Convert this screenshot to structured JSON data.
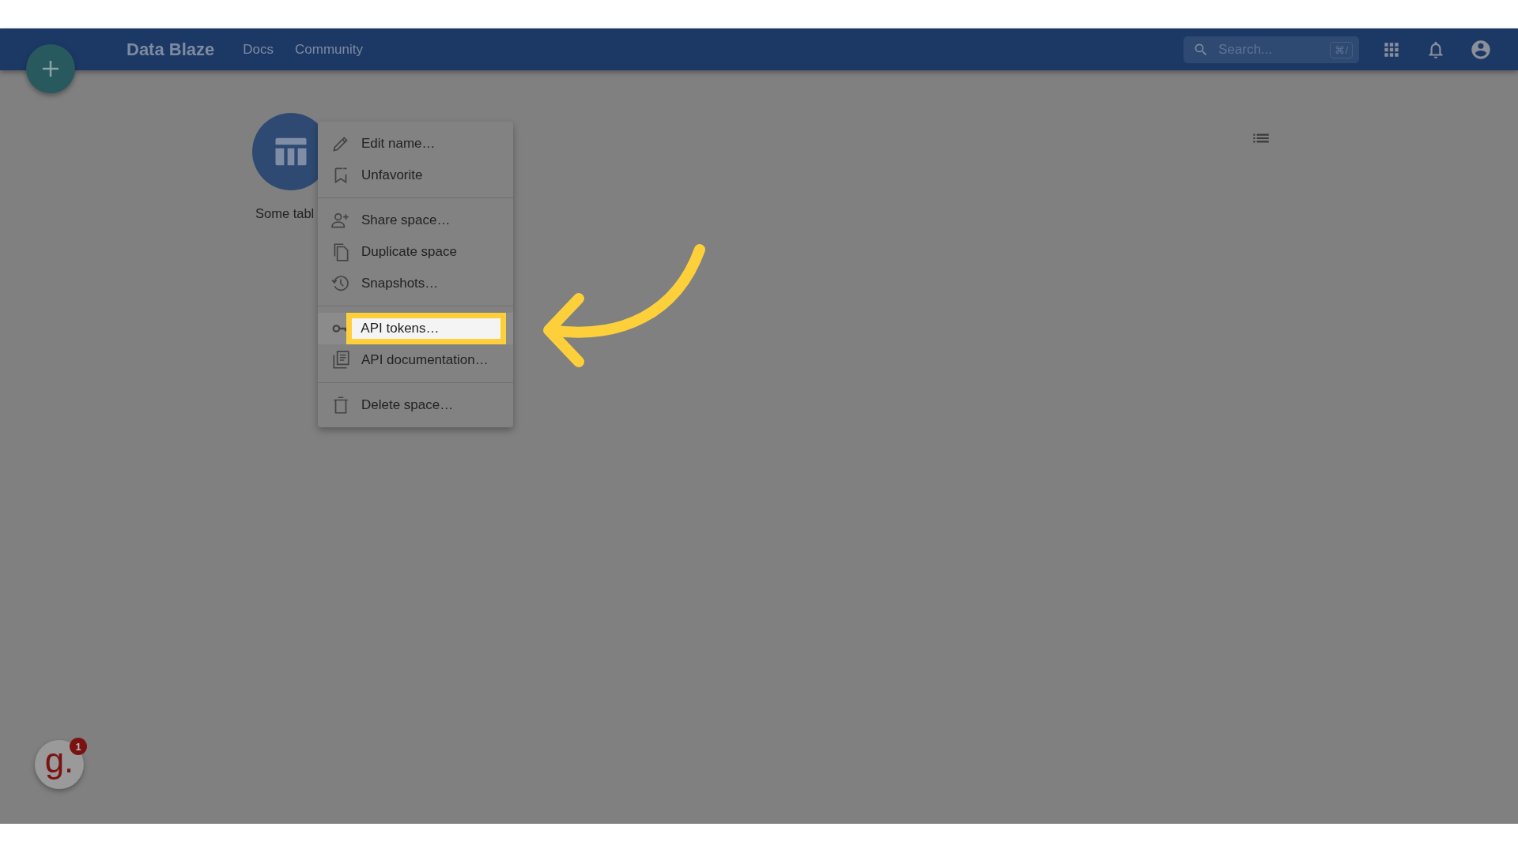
{
  "header": {
    "title": "Data Blaze",
    "links": [
      "Docs",
      "Community"
    ],
    "search": {
      "placeholder": "Search...",
      "shortcut": "⌘/"
    }
  },
  "space": {
    "name": "Some tabl"
  },
  "menu": {
    "groups": [
      [
        {
          "kind": "pencil",
          "label": "Edit name…",
          "highlighted": false
        },
        {
          "kind": "bookmark",
          "label": "Unfavorite",
          "highlighted": false
        }
      ],
      [
        {
          "kind": "share",
          "label": "Share space…",
          "highlighted": false
        },
        {
          "kind": "copy",
          "label": "Duplicate space",
          "highlighted": false
        },
        {
          "kind": "history",
          "label": "Snapshots…",
          "highlighted": false
        }
      ],
      [
        {
          "kind": "key",
          "label": "API tokens…",
          "highlighted": true
        },
        {
          "kind": "docs",
          "label": "API documentation…",
          "highlighted": false
        }
      ],
      [
        {
          "kind": "trash",
          "label": "Delete space…",
          "highlighted": false
        }
      ]
    ]
  },
  "helper": {
    "logo": "g.",
    "count": "1"
  }
}
